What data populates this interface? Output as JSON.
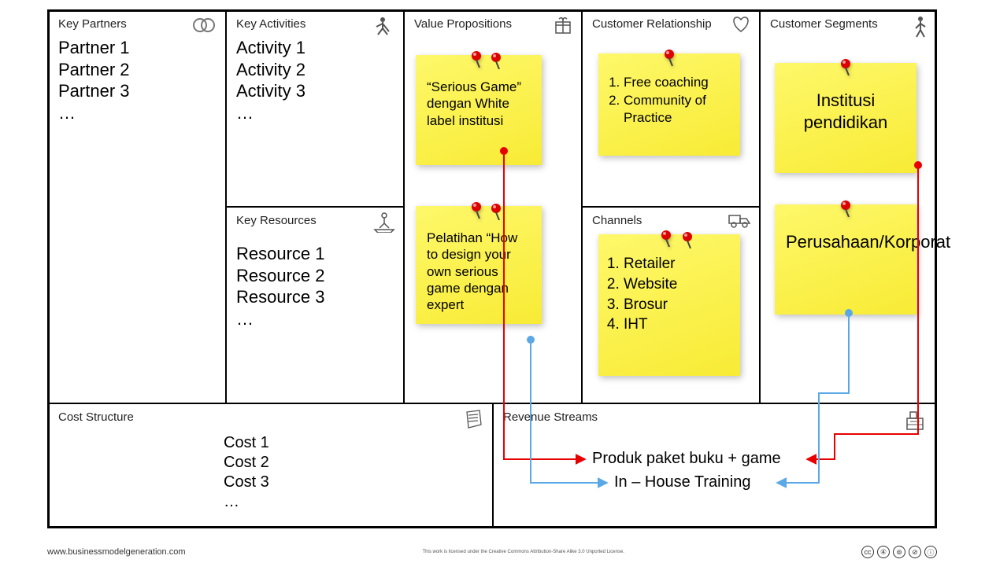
{
  "blocks": {
    "keyPartners": {
      "title": "Key Partners",
      "items": [
        "Partner 1",
        "Partner 2",
        "Partner 3",
        "…"
      ]
    },
    "keyActivities": {
      "title": "Key Activities",
      "items": [
        "Activity 1",
        "Activity 2",
        "Activity 3",
        "…"
      ]
    },
    "keyResources": {
      "title": "Key Resources",
      "items": [
        "Resource 1",
        "Resource 2",
        "Resource 3",
        "…"
      ]
    },
    "valueProps": {
      "title": "Value Propositions"
    },
    "custRel": {
      "title": "Customer Relationship"
    },
    "channels": {
      "title": "Channels"
    },
    "custSeg": {
      "title": "Customer Segments"
    },
    "costStructure": {
      "title": "Cost Structure",
      "items": [
        "Cost 1",
        "Cost 2",
        "Cost 3",
        "…"
      ]
    },
    "revenueStreams": {
      "title": "Revenue Streams"
    }
  },
  "stickies": {
    "vp1": "“Serious Game” dengan White label institusi",
    "vp2": "Pelatihan “How to design your own serious game dengan expert",
    "cr": [
      "Free coaching",
      "Community of Practice"
    ],
    "ch": [
      "Retailer",
      "Website",
      "Brosur",
      "IHT"
    ],
    "cs1": "Institusi pendidikan",
    "cs2": "Perusahaan/Korporat"
  },
  "revenue": {
    "r1": "Produk paket buku + game",
    "r2": "In – House Training"
  },
  "footer": {
    "url": "www.businessmodelgeneration.com",
    "license_tiny": "This work is licensed under the Creative Commons Attribution-Share Alike 3.0 Unported License."
  },
  "cc": [
    "cc",
    "④",
    "⊚",
    "⊘",
    "ⓘ"
  ]
}
